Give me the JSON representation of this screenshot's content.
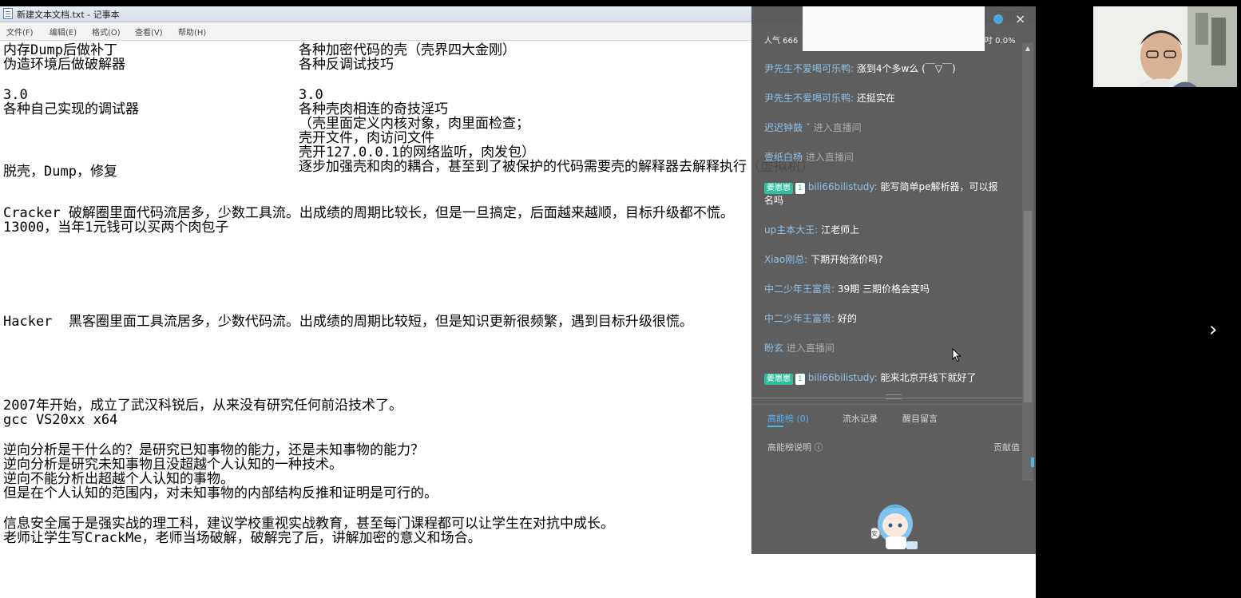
{
  "notepad": {
    "title": "新建文本文档.txt - 记事本",
    "menu": [
      "文件(F)",
      "编辑(E)",
      "格式(O)",
      "查看(V)",
      "帮助(H)"
    ],
    "controls": {
      "minimize": "_",
      "maximize": "□",
      "close": "x"
    }
  },
  "content": {
    "lines": [
      "内存Dump后做补丁",
      "伪造环境后做破解器",
      "3.0",
      "各种自己实现的调试器",
      "脱壳，Dump，修复",
      "Cracker 破解圈里面代码流居多，少数工具流。出成绩的周期比较长，但是一旦搞定，后面越来越顺，目标升级都不慌。",
      "13000，当年1元钱可以买两个肉包子",
      "Hacker  黑客圈里面工具流居多，少数代码流。出成绩的周期比较短，但是知识更新很频繁，遇到目标升级很慌。",
      "2007年开始，成立了武汉科锐后，从来没有研究任何前沿技术了。",
      "gcc VS20xx x64",
      "逆向分析是干什么的？是研究已知事物的能力，还是未知事物的能力？",
      "逆向分析是研究未知事物且没超越个人认知的一种技术。",
      "逆向不能分析出超越个人认知的事物。",
      "但是在个人认知的范围内，对未知事物的内部结构反推和证明是可行的。",
      "信息安全属于是强实战的理工科，建议学校重视实战教育，甚至每门课程都可以让学生在对抗中成长。",
      "老师让学生写CrackMe，老师当场破解，破解完了后，讲解加密的意义和场合。"
    ],
    "right_column": [
      "各种加密代码的壳（壳界四大金刚）",
      "各种反调试技巧",
      "3.0",
      "各种壳肉相连的奇技淫巧",
      "（壳里面定义内核对象，肉里面检查；",
      "壳开文件，肉访问文件",
      "壳开127.0.0.1的网络监听，肉发包）",
      "逐步加强壳和肉的耦合，甚至到了被保护的代码需要壳的解释器去解释执行（虚拟机）"
    ]
  },
  "chat": {
    "header_left": "人气 666",
    "header_right": "吋 0.0%",
    "messages": [
      {
        "user": "尹先生不爱喝可乐鸭:",
        "text": "涨到4个多w么 (￣▽￣)"
      },
      {
        "user": "尹先生不爱喝可乐鸭:",
        "text": "还挺实在"
      },
      {
        "user": "迟迟钟鼓 ˇ",
        "text": "进入直播间",
        "system": true
      },
      {
        "user": "壹纸白杨",
        "text": "进入直播间",
        "system": true
      },
      {
        "badge": "姜崽崽",
        "level": "1",
        "user": "bili66bilistudy:",
        "text": "能写简单pe解析器，可以报",
        "text2": "名吗"
      },
      {
        "user": "up主本大王:",
        "text": "江老师上"
      },
      {
        "user": "Xiao刚总:",
        "text": "下期开始涨价吗?"
      },
      {
        "user": "中二少年王富贵:",
        "text": "39期 三期价格会变吗"
      },
      {
        "user": "中二少年王富贵:",
        "text": "好的"
      },
      {
        "user": "盼玄",
        "text": "进入直播间",
        "system": true
      },
      {
        "badge": "姜崽崽",
        "level": "1",
        "user": "bili66bilistudy:",
        "text": "能来北京开线下就好了"
      }
    ],
    "tabs": [
      {
        "label": "高能榜 (0)",
        "active": true
      },
      {
        "label": "流水记录",
        "active": false
      },
      {
        "label": "醒目留言",
        "active": false
      }
    ],
    "ranking_desc": "高能榜说明 ⓘ",
    "contribution": "贡献值",
    "mascot_label": "安"
  },
  "nav": {
    "next": "›"
  }
}
